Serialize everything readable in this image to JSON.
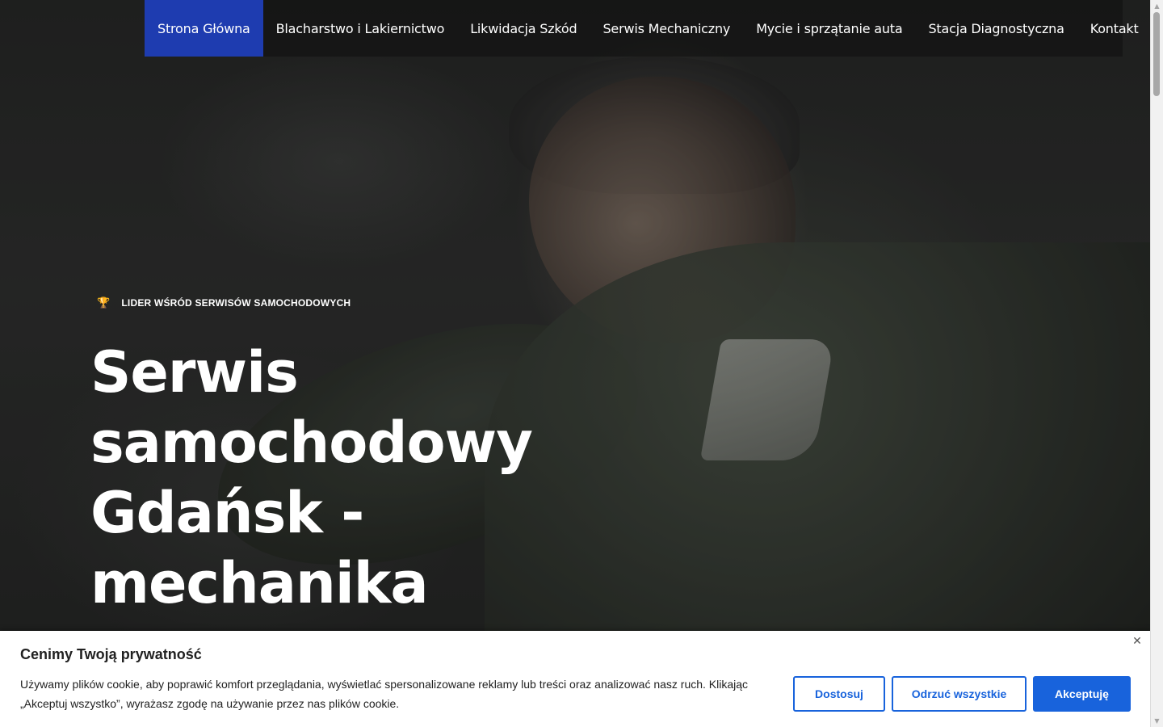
{
  "nav": {
    "items": [
      {
        "label": "Strona Główna",
        "active": true
      },
      {
        "label": "Blacharstwo i Lakiernictwo"
      },
      {
        "label": "Likwidacja Szkód"
      },
      {
        "label": "Serwis Mechaniczny"
      },
      {
        "label": "Mycie i sprzątanie auta"
      },
      {
        "label": "Stacja Diagnostyczna"
      },
      {
        "label": "Kontakt"
      }
    ]
  },
  "hero": {
    "badge_icon": "trophy-icon",
    "badge_text": "LIDER WŚRÓD SERWISÓW SAMOCHODOWYCH",
    "title_lines": [
      "Serwis",
      "samochodowy",
      "Gdańsk -",
      "mechanika"
    ]
  },
  "cookie": {
    "title": "Cenimy Twoją prywatność",
    "text": "Używamy plików cookie, aby poprawić komfort przeglądania, wyświetlać spersonalizowane reklamy lub treści oraz analizować nasz ruch. Klikając „Akceptuj wszystko”, wyrażasz zgodę na używanie przez nas plików cookie.",
    "buttons": {
      "customize": "Dostosuj",
      "reject": "Odrzuć wszystkie",
      "accept": "Akceptuję"
    }
  },
  "colors": {
    "nav_active": "#1e3cb0",
    "cookie_accent": "#1863dc",
    "badge_icon": "#e4a13a"
  }
}
